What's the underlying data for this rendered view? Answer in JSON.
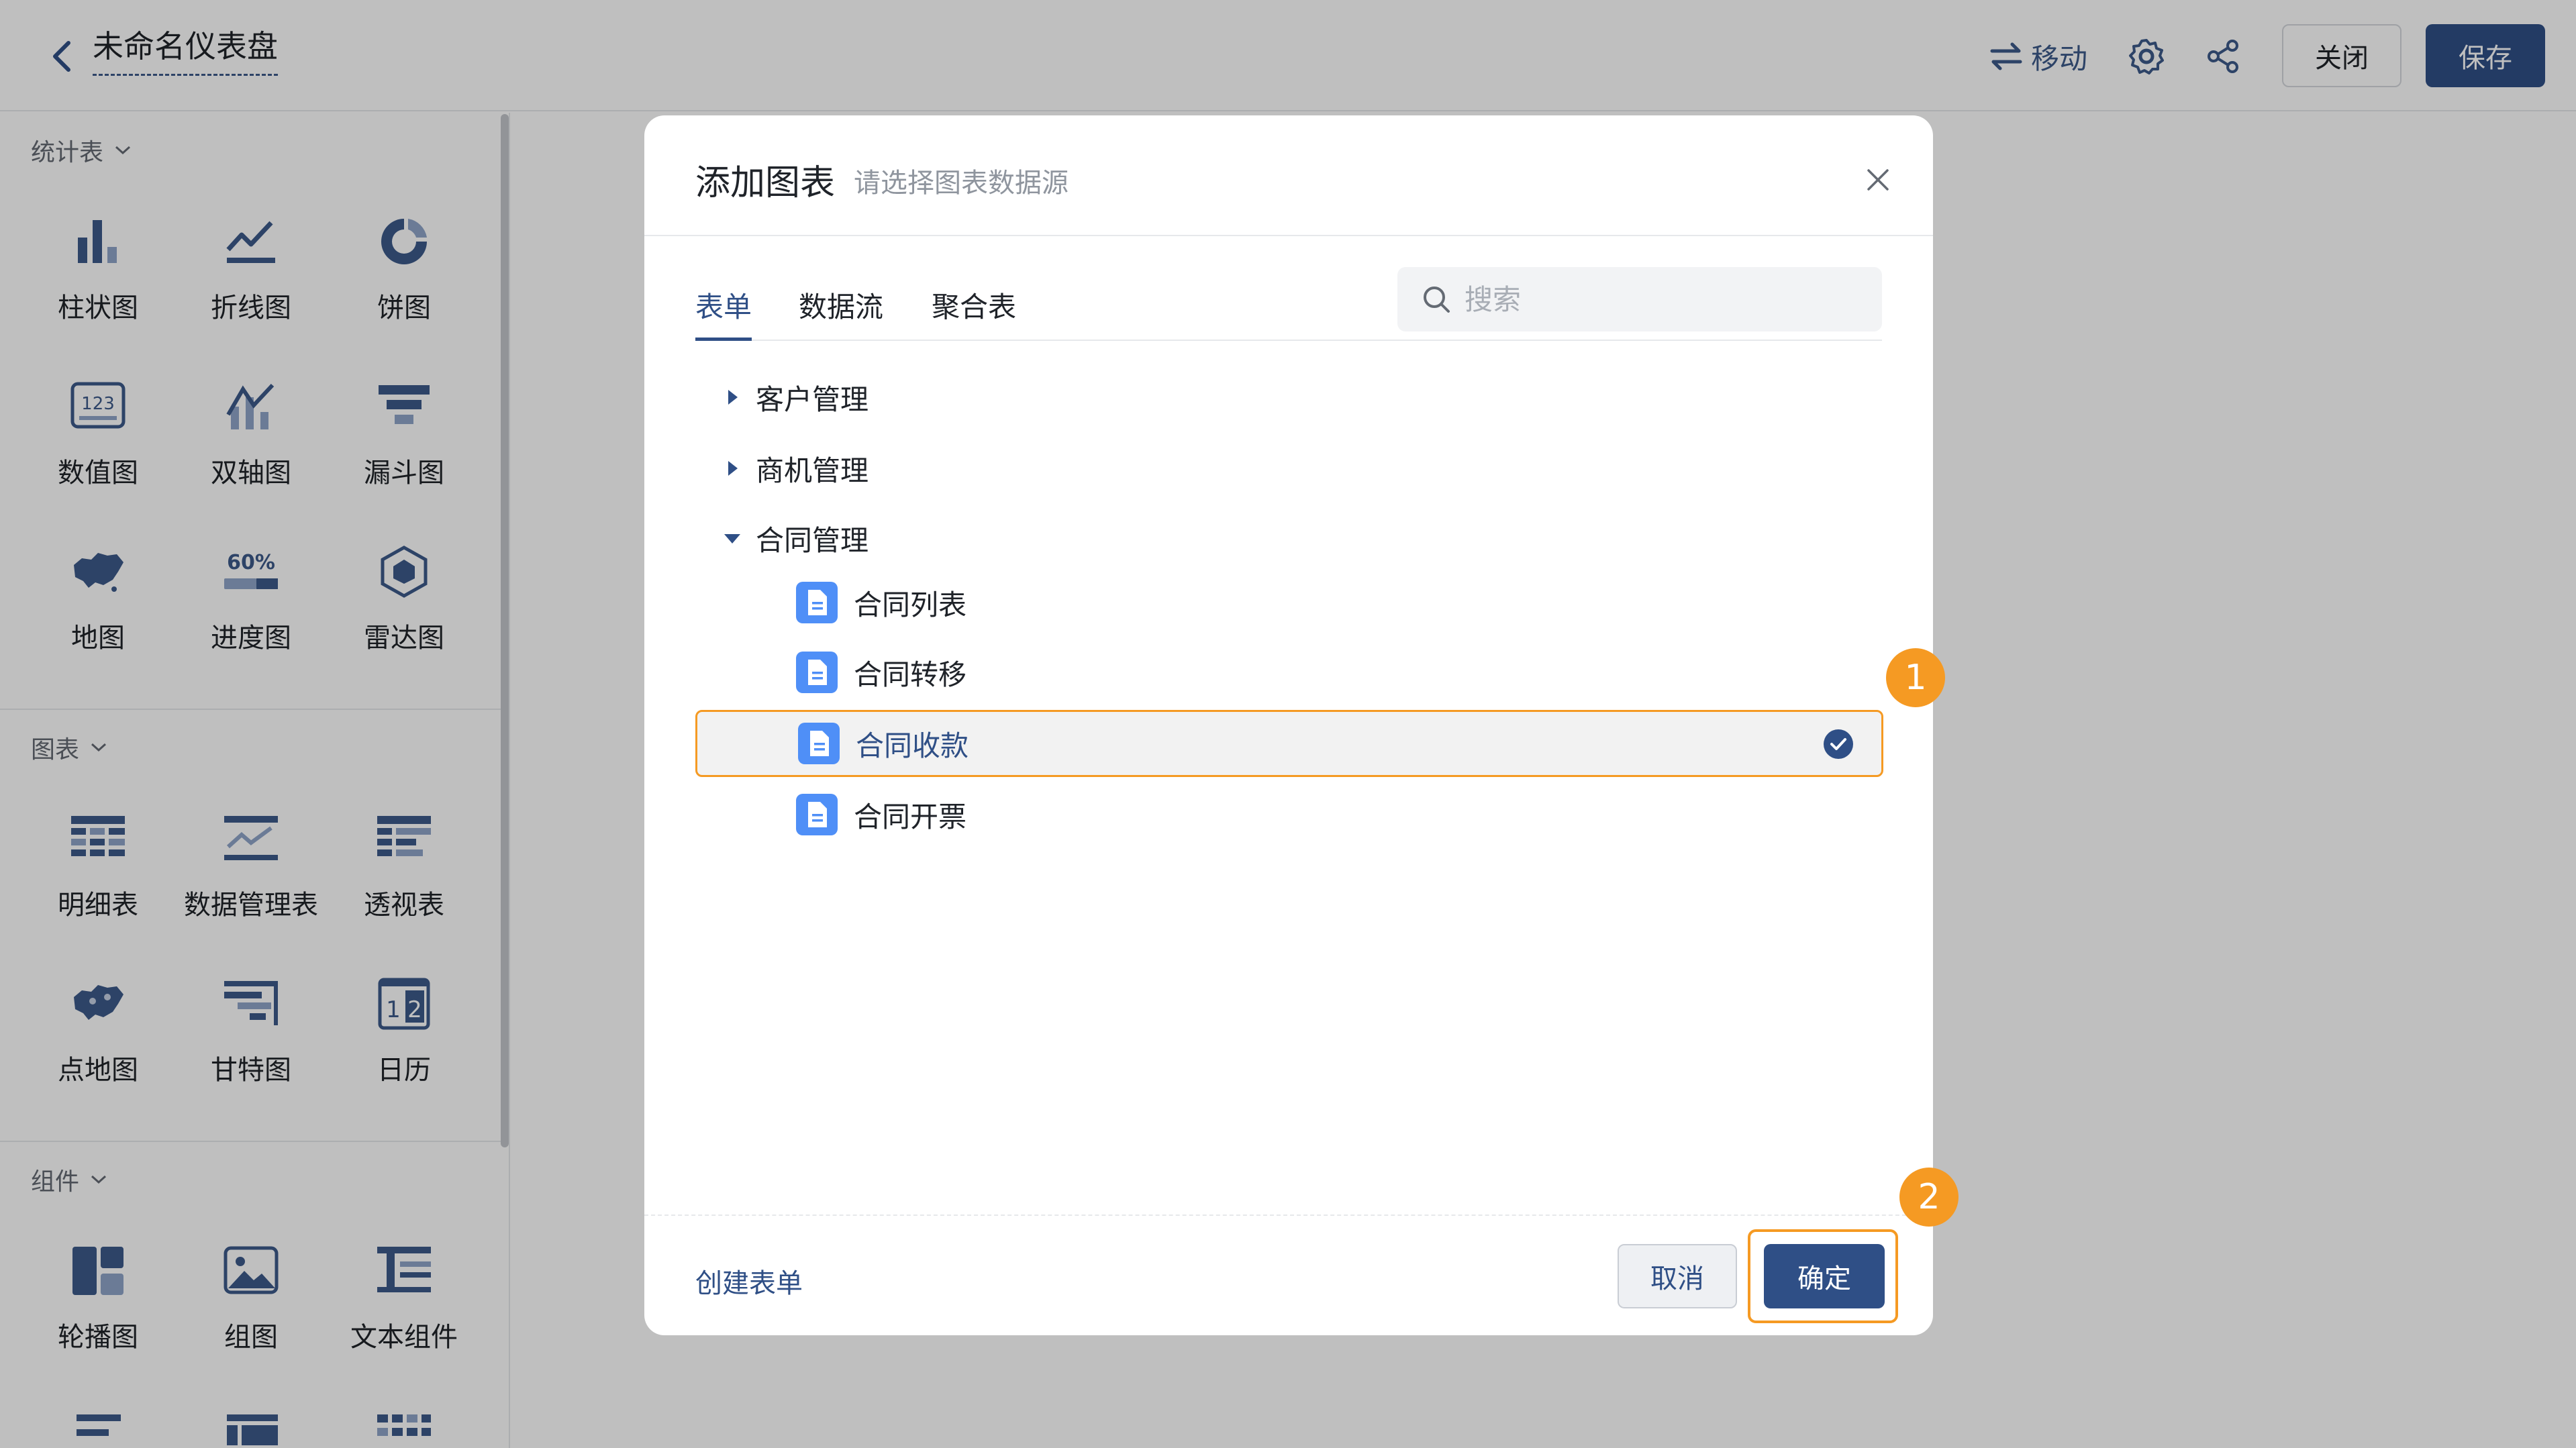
{
  "header": {
    "back_icon": "chevron-left-icon",
    "title": "未命名仪表盘",
    "move_label": "移动",
    "close_label": "关闭",
    "save_label": "保存",
    "accent_color": "#2f4f86"
  },
  "sidebar": {
    "stats_section": "统计表",
    "stats_items": [
      "柱状图",
      "折线图",
      "饼图",
      "数值图",
      "双轴图",
      "漏斗图",
      "地图",
      "进度图",
      "雷达图"
    ],
    "progress_icon_text": "60%",
    "number_icon_text": "123",
    "chart_section": "图表",
    "chart_items": [
      "明细表",
      "数据管理表",
      "透视表",
      "点地图",
      "甘特图",
      "日历"
    ],
    "calendar_icon_text_1": "1",
    "calendar_icon_text_2": "2",
    "component_section": "组件",
    "component_items": [
      "轮播图",
      "组图",
      "文本组件"
    ]
  },
  "modal": {
    "title": "添加图表",
    "subtitle": "请选择图表数据源",
    "tabs": [
      "表单",
      "数据流",
      "聚合表"
    ],
    "active_tab": "表单",
    "search_placeholder": "搜索",
    "groups": [
      "客户管理",
      "商机管理",
      "合同管理"
    ],
    "expanded_group": "合同管理",
    "forms": [
      "合同列表",
      "合同转移",
      "合同收款",
      "合同开票"
    ],
    "selected_form": "合同收款",
    "create_link": "创建表单",
    "cancel_label": "取消",
    "ok_label": "确定",
    "highlight_color": "#f59a23"
  },
  "markers": [
    "1",
    "2"
  ]
}
